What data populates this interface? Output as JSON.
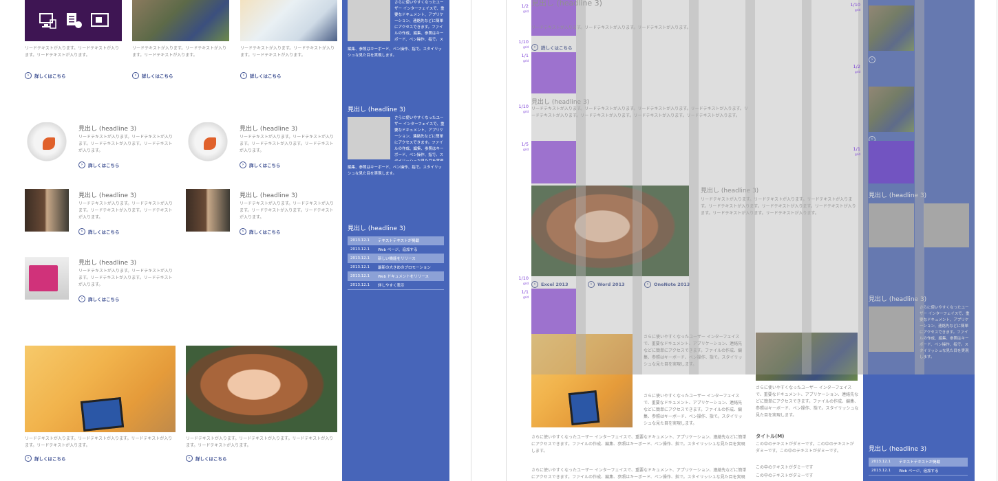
{
  "body_text": "リードテキストが入ります。リードテキストが入ります。リードテキストが入ります。リードテキストが入ります。",
  "body_text_short": "リードテキストが入ります。リードテキストが入ります。リードテキストが入ります。",
  "body_text_long": "リードテキストが入ります。リードテキストが入ります。リードテキストが入ります。リードテキストが入ります。リードテキストが入ります。リードテキストが入ります。リードテキストが入ります。リードテキストが入ります。",
  "more_link": "詳しくはこちら",
  "headline": "見出し (headline 3)",
  "sidebar_text": "さらに使いやすくなったユーザー インターフェイスで、重要なドキュメント、アプリケーション、連絡先などに簡単にアクセスできます。ファイルの作成、編集、参照はキーボード、ペン操作、指で。スタイリッシュな見た目を実現します。",
  "sidebar_text_short": "編集、参照はキーボード、ペン操作、指で。スタイリッシュな見た目を実現します。",
  "news": [
    {
      "date": "2013.12.1",
      "title": "テキストテキストが掲載"
    },
    {
      "date": "2013.12.1",
      "title": "Web ページ、追加する"
    },
    {
      "date": "2013.12.1",
      "title": "新しい機能をリリース"
    },
    {
      "date": "2013.12.1",
      "title": "最新の大きめのプロモーション"
    },
    {
      "date": "2013.12.1",
      "title": "Web ドキュメントをリリース"
    },
    {
      "date": "2013.12.1",
      "title": "詳しやすく表示"
    }
  ],
  "right": {
    "headline_top": "見出し (headline 3)",
    "grid_marks": [
      "1/2",
      "1/10",
      "1/1",
      "1/10",
      "1/5",
      "1/10",
      "1/1",
      "1/10",
      "1/2",
      "1/1"
    ],
    "grid_mark_unit": "grid",
    "apps": [
      "Excel 2013",
      "Word 2013",
      "OneNote 2013"
    ],
    "title_m": "タイトル(M)",
    "title_m_text": "この中のテキストがダミーです。この中のテキストがダミーです。この中のテキストがダミーです。",
    "list_items": [
      "この中のテキストがダミーです",
      "この中のテキストがダミーです"
    ],
    "news": [
      {
        "date": "2013.12.1",
        "title": "テキストテキストが掲載"
      },
      {
        "date": "2013.12.1",
        "title": "Web ページ、追加する"
      }
    ]
  },
  "colors": {
    "accent_blue": "#4765b9",
    "grid_purple": "#9b59e6",
    "link": "#3d4f91"
  },
  "icons": [
    "computer-icon",
    "document-icon",
    "tablet-icon"
  ]
}
